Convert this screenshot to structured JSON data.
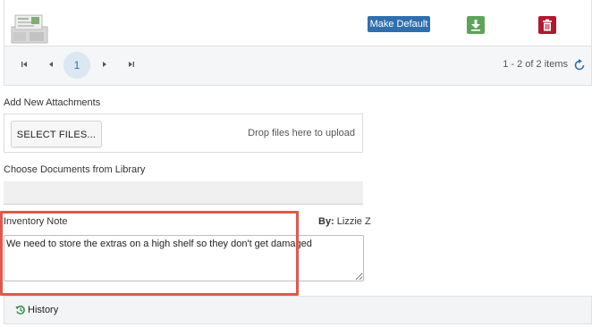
{
  "attachments": {
    "row": {
      "thumb_icon": "document-thumbnail-icon",
      "make_default_label": "Make Default",
      "download_icon": "download-icon",
      "delete_icon": "trash-icon"
    },
    "pager": {
      "first_icon": "first-page-icon",
      "prev_icon": "prev-page-icon",
      "current_page": "1",
      "next_icon": "next-page-icon",
      "last_icon": "last-page-icon",
      "info": "1 - 2 of 2 items",
      "refresh_icon": "refresh-icon"
    }
  },
  "upload": {
    "title": "Add New Attachments",
    "select_label": "SELECT FILES...",
    "drop_hint": "Drop files here to upload"
  },
  "library": {
    "title": "Choose Documents from Library",
    "value": ""
  },
  "note": {
    "title": "Inventory Note",
    "by_label": "By:",
    "by_value": "Lizzie Z",
    "text": "We need to store the extras on a high shelf so they don't get damaged"
  },
  "history": {
    "icon": "history-icon",
    "label": "History"
  },
  "colors": {
    "primary": "#2f6fae",
    "success": "#5ea35a",
    "danger": "#b0192f",
    "highlight": "#e2574c"
  }
}
